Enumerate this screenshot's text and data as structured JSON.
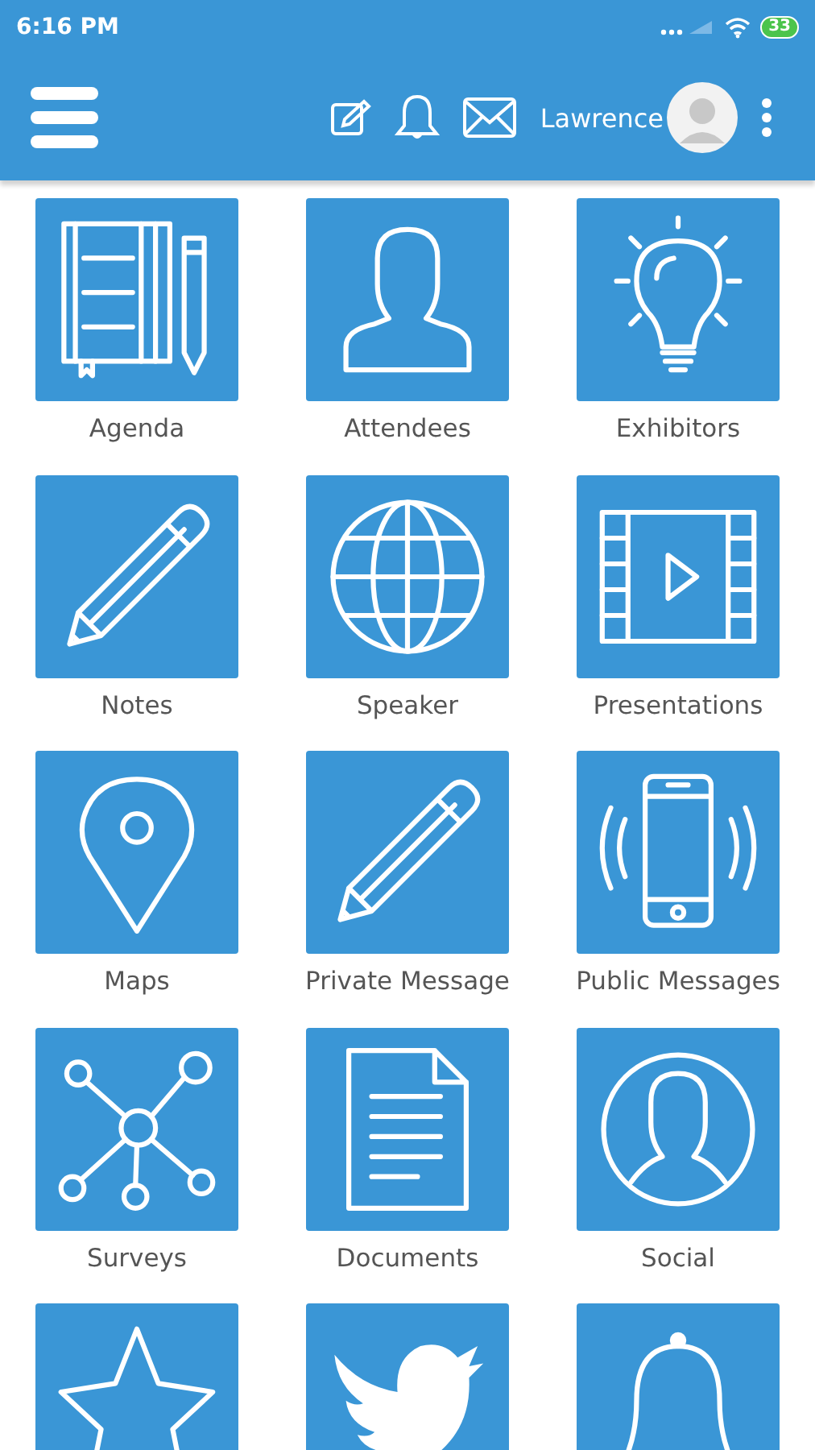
{
  "status_bar": {
    "time": "6:16 PM",
    "battery": "33"
  },
  "header": {
    "user_name": "Lawrence"
  },
  "tiles": [
    {
      "label": "Agenda"
    },
    {
      "label": "Attendees"
    },
    {
      "label": "Exhibitors"
    },
    {
      "label": "Notes"
    },
    {
      "label": "Speaker"
    },
    {
      "label": "Presentations"
    },
    {
      "label": "Maps"
    },
    {
      "label": "Private Message"
    },
    {
      "label": "Public Messages"
    },
    {
      "label": "Surveys"
    },
    {
      "label": "Documents"
    },
    {
      "label": "Social"
    }
  ]
}
